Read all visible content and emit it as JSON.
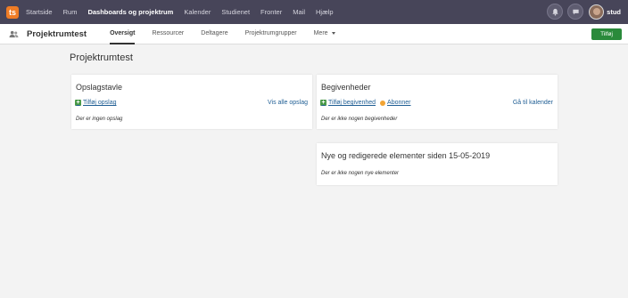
{
  "topbar": {
    "logo_letter": "ts",
    "nav": [
      "Startside",
      "Rum",
      "Dashboards og projektrum",
      "Kalender",
      "Studienet",
      "Fronter",
      "Mail",
      "Hjælp"
    ],
    "active_index": 2,
    "user_name": "stud",
    "icons": [
      "bell-icon",
      "chat-icon"
    ]
  },
  "subbar": {
    "room_title": "Projektrumtest",
    "tabs": [
      "Oversigt",
      "Ressourcer",
      "Deltagere",
      "Projektrumgrupper",
      "Mere"
    ],
    "active_tab": 0,
    "add_button": "Tilføj"
  },
  "page": {
    "title": "Projektrumtest"
  },
  "bulletin": {
    "title": "Opslagstavle",
    "add_link": "Tilføj opslag",
    "view_all": "Vis alle opslag",
    "empty": "Der er ingen opslag"
  },
  "events": {
    "title": "Begivenheder",
    "add_link": "Tilføj begivenhed",
    "subscribe": "Abonner",
    "calendar_link": "Gå til kalender",
    "empty": "Der er ikke nogen begivenheder"
  },
  "recent": {
    "title": "Nye og redigerede elementer siden 15-05-2019",
    "empty": "Der er ikke nogen nye elementer"
  },
  "colors": {
    "topbar": "#474559",
    "logo": "#ef7c25",
    "add_button": "#2a8a3b",
    "link": "#1f5e94",
    "background": "#f3f3f3"
  }
}
